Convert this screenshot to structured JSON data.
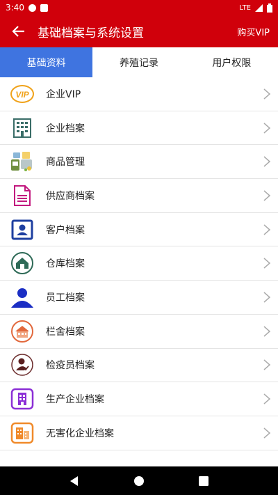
{
  "status": {
    "time": "3:40",
    "network": "LTE"
  },
  "appbar": {
    "title": "基础档案与系统设置",
    "action": "购买VIP"
  },
  "tabs": [
    {
      "label": "基础资料",
      "active": true
    },
    {
      "label": "养殖记录",
      "active": false
    },
    {
      "label": "用户权限",
      "active": false
    }
  ],
  "items": [
    {
      "label": "企业VIP",
      "icon": "vip-icon",
      "icon_text": "VIP"
    },
    {
      "label": "企业档案",
      "icon": "building-icon"
    },
    {
      "label": "商品管理",
      "icon": "products-icon"
    },
    {
      "label": "供应商档案",
      "icon": "document-icon"
    },
    {
      "label": "客户档案",
      "icon": "customer-card-icon"
    },
    {
      "label": "仓库档案",
      "icon": "warehouse-icon"
    },
    {
      "label": "员工档案",
      "icon": "person-icon"
    },
    {
      "label": "栏舍档案",
      "icon": "barn-icon"
    },
    {
      "label": "检疫员档案",
      "icon": "inspector-icon"
    },
    {
      "label": "生产企业档案",
      "icon": "factory-icon"
    },
    {
      "label": "无害化企业档案",
      "icon": "plant-icon"
    }
  ],
  "colors": {
    "primary": "#d0000b",
    "tab_active": "#3f74e0"
  }
}
